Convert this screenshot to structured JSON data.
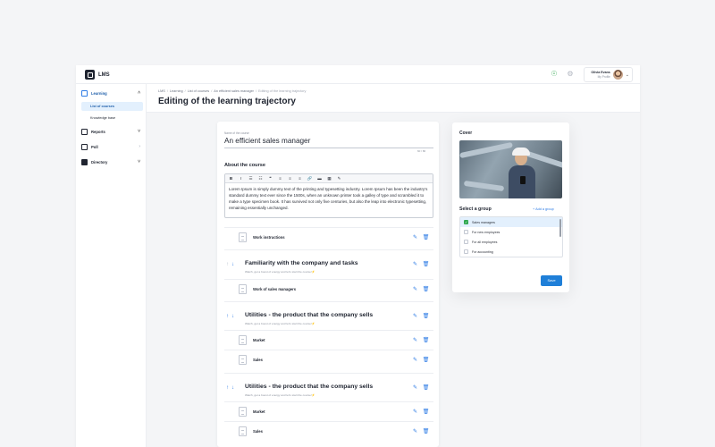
{
  "app": {
    "logo_text": "LMS"
  },
  "user": {
    "name": "Olivia Evans",
    "role": "My Profile"
  },
  "sidebar": {
    "learning": "Learning",
    "list_of_courses": "List of courses",
    "knowledge_base": "Knowledge base",
    "reports": "Reports",
    "poll": "Poll",
    "directory": "Directory"
  },
  "breadcrumbs": [
    "LMS",
    "Learning",
    "List of courses",
    "An efficient sales manager",
    "Editing of the learning trajectory"
  ],
  "page_title": "Editing of the learning trajectory",
  "course": {
    "name_label": "Name of the course",
    "name": "An efficient sales manager",
    "char_count": "60 / 80",
    "about_label": "About the course",
    "about_text": "Lorem Ipsum is simply dummy text of the printing and typesetting industry. Lorem Ipsum has been the industry's standard dummy text ever since the 1500s, when an unknown printer took a galley of type and scrambled it to make a type specimen book. It has survived not only five centuries, but also the leap into electronic typesetting, remaining essentially unchanged.",
    "toolbar": [
      "B",
      "I",
      "☰",
      "☷",
      "❝",
      "≡",
      "≡",
      "≡",
      "🔗",
      "▬",
      "▦",
      "✎"
    ]
  },
  "lessons": {
    "work_instructions": "Work instructions",
    "work_of_sales_managers": "Work of sales managers",
    "market_1": "Market",
    "sales_1": "Sales",
    "market_2": "Market",
    "sales_2": "Sales"
  },
  "sections": [
    {
      "title": "Familiarity with the company and tasks",
      "subtitle": "Watch, get a boost of energy and let's start the course!⚡"
    },
    {
      "title": "Utilities - the product that the company sells",
      "subtitle": "Watch, get a boost of energy and let's start the course!⚡"
    },
    {
      "title": "Utilities - the product that the company sells",
      "subtitle": "Watch, get a boost of energy and let's start the course!⚡"
    }
  ],
  "cover": {
    "label": "Cover",
    "group_label": "Select a group",
    "add_group": "+ Add a group",
    "groups": [
      "Sales managers",
      "For new employees",
      "For all employees",
      "For accounting"
    ],
    "save": "Save"
  },
  "colors": {
    "accent": "#2d7be5",
    "primary_button": "#1f7fd8",
    "check": "#2fa84f",
    "selected_bg": "#e3f0fd"
  }
}
